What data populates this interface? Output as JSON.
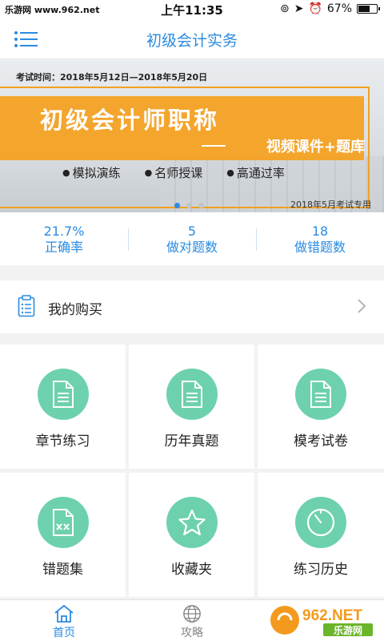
{
  "status_bar": {
    "carrier": "乐游网 www.962.net",
    "time": "上午11:35",
    "battery": "67%",
    "battery_level": 0.67
  },
  "nav": {
    "title": "初级会计实务",
    "menu_icon": "menu-icon"
  },
  "banner": {
    "exam_time": "考试时间：2018年5月12日—2018年5月20日",
    "title": "初级会计师职称",
    "subtitle": "视频课件+题库",
    "features": [
      "模拟演练",
      "名师授课",
      "高通过率"
    ],
    "note": "2018年5月考试专用",
    "dot_count": 3,
    "active_dot": 0
  },
  "stats": [
    {
      "value": "21.7%",
      "label": "正确率"
    },
    {
      "value": "5",
      "label": "做对题数"
    },
    {
      "value": "18",
      "label": "做错题数"
    }
  ],
  "purchase": {
    "label": "我的购买"
  },
  "grid": [
    {
      "label": "章节练习",
      "icon": "document-icon"
    },
    {
      "label": "历年真题",
      "icon": "document-icon"
    },
    {
      "label": "模考试卷",
      "icon": "document-icon"
    },
    {
      "label": "错题集",
      "icon": "wrong-document-icon"
    },
    {
      "label": "收藏夹",
      "icon": "star-icon"
    },
    {
      "label": "练习历史",
      "icon": "history-icon"
    }
  ],
  "tabs": [
    {
      "label": "首页",
      "icon": "home-icon",
      "active": true
    },
    {
      "label": "攻略",
      "icon": "globe-icon",
      "active": false
    }
  ],
  "watermark": {
    "logo_text": "962.NET",
    "sub_text": "乐游网"
  },
  "colors": {
    "accent": "#2a8be0",
    "icon_green": "#6dd1ad",
    "banner_orange": "#f5a01e"
  }
}
